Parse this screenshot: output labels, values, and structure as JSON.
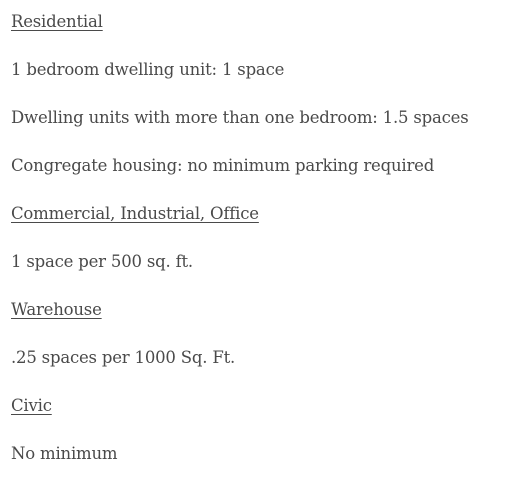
{
  "sections": [
    {
      "heading": "Residential",
      "items": [
        "1 bedroom dwelling unit: 1 space",
        "Dwelling units with more than one bedroom: 1.5 spaces",
        "Congregate housing: no minimum parking required"
      ]
    },
    {
      "heading": "Commercial, Industrial, Office",
      "items": [
        "1 space per 500 sq. ft."
      ]
    },
    {
      "heading": "Warehouse",
      "items": [
        ".25 spaces per 1000 Sq. Ft."
      ]
    },
    {
      "heading": "Civic",
      "items": [
        "No minimum"
      ]
    }
  ]
}
